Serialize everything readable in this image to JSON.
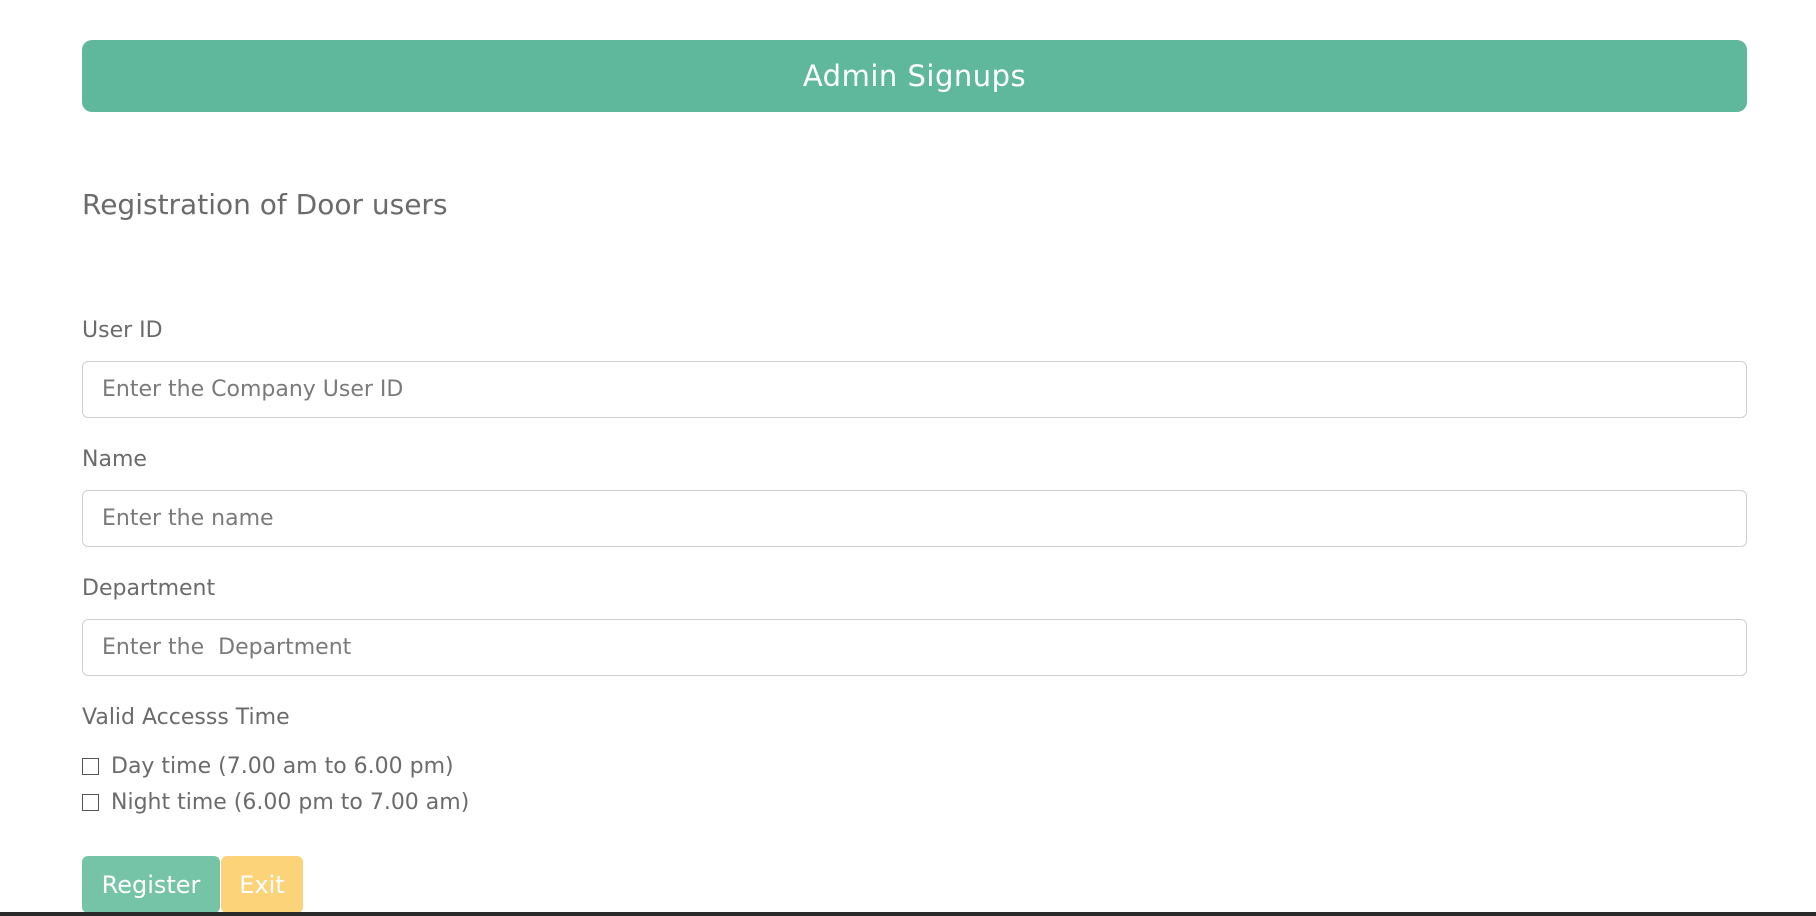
{
  "header": {
    "title": "Admin Signups",
    "color": "#5fb89c"
  },
  "form": {
    "subtitle": "Registration of Door users",
    "user_id": {
      "label": "User ID",
      "placeholder": "Enter the Company User ID",
      "value": ""
    },
    "name": {
      "label": "Name",
      "placeholder": "Enter the name",
      "value": ""
    },
    "department": {
      "label": "Department",
      "placeholder": "Enter the  Department",
      "value": ""
    },
    "access_time": {
      "label": "Valid Accesss Time",
      "options": [
        {
          "label": "Day time (7.00 am to 6.00 pm)",
          "checked": false
        },
        {
          "label": "Night time (6.00 pm to 7.00 am)",
          "checked": false
        }
      ]
    }
  },
  "actions": {
    "register_label": "Register",
    "register_color": "#76c4a8",
    "exit_label": "Exit",
    "exit_color": "#fdd37a"
  }
}
